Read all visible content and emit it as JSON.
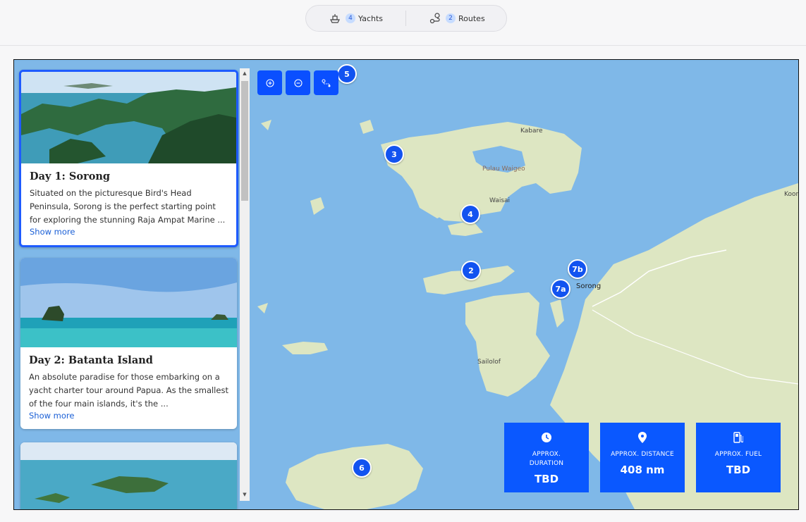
{
  "header": {
    "yachts": {
      "count": "4",
      "label": "Yachts",
      "icon": "yacht-icon"
    },
    "routes": {
      "count": "2",
      "label": "Routes",
      "icon": "route-icon"
    }
  },
  "cards": [
    {
      "title": "Day 1: Sorong",
      "text": "Situated on the picturesque Bird's Head Peninsula, Sorong is the perfect starting point for exploring the stunning Raja Ampat Marine ...",
      "more": "Show more"
    },
    {
      "title": "Day 2: Batanta Island",
      "text": "An absolute paradise for those embarking on a yacht charter tour around Papua. As the smallest of the four main islands, it's the ...",
      "more": "Show more"
    }
  ],
  "map_controls": {
    "zoom_in": "zoom-in-icon",
    "zoom_out": "zoom-out-icon",
    "route": "route-toggle-icon"
  },
  "markers": [
    "5",
    "3",
    "4",
    "2",
    "7b",
    "7a",
    "6"
  ],
  "places": {
    "kabare": "Kabare",
    "waigeo": "Pulau Waigeo",
    "waisai": "Waisai",
    "sorong": "Sorong",
    "sailolof": "Sailolof",
    "koor": "Koor"
  },
  "stats": [
    {
      "label": "APPROX. DURATION",
      "value": "TBD",
      "icon": "clock-icon"
    },
    {
      "label": "APPROX. DISTANCE",
      "value": "408 nm",
      "icon": "pin-icon"
    },
    {
      "label": "APPROX. FUEL",
      "value": "TBD",
      "icon": "fuel-icon"
    }
  ],
  "colors": {
    "accent": "#0a58ff",
    "sea": "#7fb8e8",
    "land": "#dde6c2"
  }
}
